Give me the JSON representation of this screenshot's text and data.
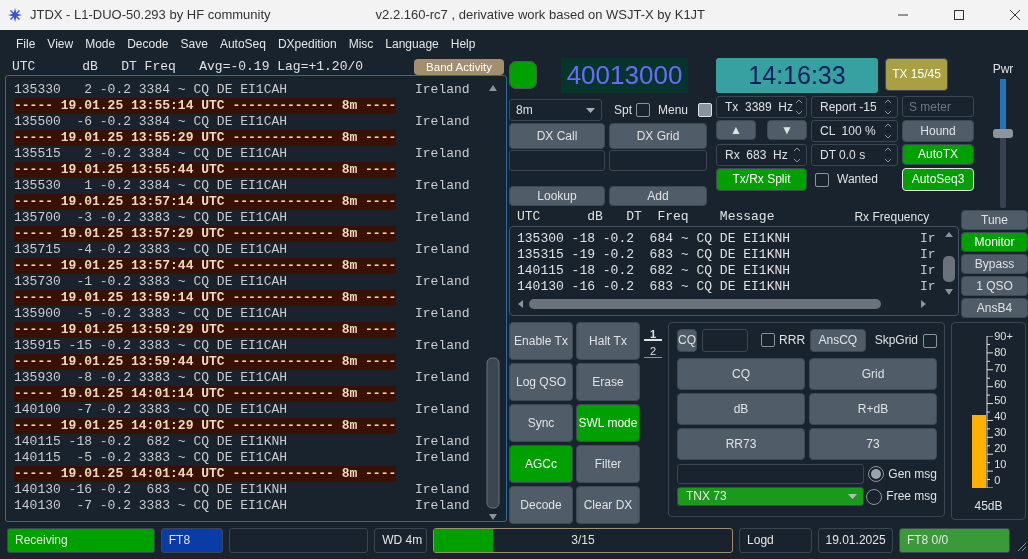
{
  "window": {
    "title": "JTDX - L1-DUO-50.293  by HF community",
    "subtitle": "v2.2.160-rc7 , derivative work based on WSJT-X by K1JT"
  },
  "menu": [
    "File",
    "View",
    "Mode",
    "Decode",
    "Save",
    "AutoSeq",
    "DXpedition",
    "Misc",
    "Language",
    "Help"
  ],
  "band_activity": {
    "header": "UTC      dB   DT Freq   Avg=-0.19 Lag=+1.20/0",
    "title": "Band Activity",
    "rows": [
      {
        "kind": "decode",
        "text": "135330   2 -0.2 3384 ~ CQ DE EI1CAH",
        "country": "Ireland"
      },
      {
        "kind": "separator",
        "text": "----- 19.01.25 13:55:14 UTC ------------- 8m ----"
      },
      {
        "kind": "decode",
        "text": "135500  -6 -0.2 3384 ~ CQ DE EI1CAH",
        "country": "Ireland"
      },
      {
        "kind": "separator",
        "text": "----- 19.01.25 13:55:29 UTC ------------- 8m ----"
      },
      {
        "kind": "decode",
        "text": "135515   2 -0.2 3384 ~ CQ DE EI1CAH",
        "country": "Ireland"
      },
      {
        "kind": "separator",
        "text": "----- 19.01.25 13:55:44 UTC ------------- 8m ----"
      },
      {
        "kind": "decode",
        "text": "135530   1 -0.2 3384 ~ CQ DE EI1CAH",
        "country": "Ireland"
      },
      {
        "kind": "separator",
        "text": "----- 19.01.25 13:57:14 UTC ------------- 8m ----"
      },
      {
        "kind": "decode",
        "text": "135700  -3 -0.2 3383 ~ CQ DE EI1CAH",
        "country": "Ireland"
      },
      {
        "kind": "separator",
        "text": "----- 19.01.25 13:57:29 UTC ------------- 8m ----"
      },
      {
        "kind": "decode",
        "text": "135715  -4 -0.2 3383 ~ CQ DE EI1CAH",
        "country": "Ireland"
      },
      {
        "kind": "separator",
        "text": "----- 19.01.25 13:57:44 UTC ------------- 8m ----"
      },
      {
        "kind": "decode",
        "text": "135730  -1 -0.2 3383 ~ CQ DE EI1CAH",
        "country": "Ireland"
      },
      {
        "kind": "separator",
        "text": "----- 19.01.25 13:59:14 UTC ------------- 8m ----"
      },
      {
        "kind": "decode",
        "text": "135900  -5 -0.2 3383 ~ CQ DE EI1CAH",
        "country": "Ireland"
      },
      {
        "kind": "separator",
        "text": "----- 19.01.25 13:59:29 UTC ------------- 8m ----"
      },
      {
        "kind": "decode",
        "text": "135915 -15 -0.2 3383 ~ CQ DE EI1CAH",
        "country": "Ireland"
      },
      {
        "kind": "separator",
        "text": "----- 19.01.25 13:59:44 UTC ------------- 8m ----"
      },
      {
        "kind": "decode",
        "text": "135930  -8 -0.2 3383 ~ CQ DE EI1CAH",
        "country": "Ireland"
      },
      {
        "kind": "separator",
        "text": "----- 19.01.25 14:01:14 UTC ------------- 8m ----"
      },
      {
        "kind": "decode",
        "text": "140100  -7 -0.2 3383 ~ CQ DE EI1CAH",
        "country": "Ireland"
      },
      {
        "kind": "separator",
        "text": "----- 19.01.25 14:01:29 UTC ------------- 8m ----"
      },
      {
        "kind": "decode",
        "text": "140115 -18 -0.2  682 ~ CQ DE EI1KNH",
        "country": "Ireland"
      },
      {
        "kind": "decode",
        "text": "140115  -5 -0.2 3383 ~ CQ DE EI1CAH",
        "country": "Ireland"
      },
      {
        "kind": "separator",
        "text": "----- 19.01.25 14:01:44 UTC ------------- 8m ----"
      },
      {
        "kind": "decode",
        "text": "140130 -16 -0.2  683 ~ CQ DE EI1KNH",
        "country": "Ireland"
      },
      {
        "kind": "decode",
        "text": "140130  -7 -0.2 3383 ~ CQ DE EI1CAH",
        "country": "Ireland"
      }
    ]
  },
  "controls": {
    "monitor_led": {
      "on": true
    },
    "frequency": "40013000",
    "clock": "14:16:33",
    "tx_period": "TX 15/45",
    "power": {
      "label": "Pwr",
      "level": 0.6
    },
    "band": "8m",
    "spot": {
      "label": "Spt",
      "checked": false
    },
    "menu_toggle": {
      "label": "Menu",
      "checked": true
    },
    "tx_freq": "Tx  3389  Hz",
    "report": "Report -15",
    "s_meter": {
      "placeholder": "S meter"
    },
    "dx_call": "DX Call",
    "dx_grid": "DX Grid",
    "up": "▲",
    "down": "▼",
    "cl": "CL  100 %",
    "hound": {
      "label": "Hound",
      "on": false
    },
    "rx_freq": "Rx  683  Hz",
    "dt": "DT 0.0 s",
    "auto_tx": {
      "label": "AutoTX",
      "on": true
    },
    "split": {
      "label": "Tx/Rx Split",
      "on": true
    },
    "wanted": {
      "label": "Wanted",
      "checked": false
    },
    "auto_seq": {
      "label": "AutoSeq3",
      "on": true
    },
    "lookup": "Lookup",
    "add": "Add"
  },
  "rx_frequency": {
    "header": "UTC      dB   DT  Freq    Message",
    "title": "Rx Frequency",
    "rows": [
      {
        "text": "135300 -18 -0.2  684 ~ CQ DE EI1KNH",
        "country": "Ir"
      },
      {
        "text": "135315 -19 -0.2  683 ~ CQ DE EI1KNH",
        "country": "Ir"
      },
      {
        "text": "140115 -18 -0.2  682 ~ CQ DE EI1KNH",
        "country": "Ir"
      },
      {
        "text": "140130 -16 -0.2  683 ~ CQ DE EI1KNH",
        "country": "Ir"
      }
    ]
  },
  "side_buttons": [
    {
      "label": "Tune",
      "on": false
    },
    {
      "label": "Monitor",
      "on": true
    },
    {
      "label": "Bypass",
      "on": false
    },
    {
      "label": "1 QSO",
      "on": false
    },
    {
      "label": "AnsB4",
      "on": false
    }
  ],
  "action_buttons": [
    {
      "label": "Enable Tx",
      "on": false
    },
    {
      "label": "Halt Tx",
      "on": false
    },
    {
      "label": "Log QSO",
      "on": false
    },
    {
      "label": "Erase",
      "on": false
    },
    {
      "label": "Sync",
      "on": false
    },
    {
      "label": "SWL mode",
      "on": true
    },
    {
      "label": "AGCc",
      "on": true
    },
    {
      "label": "Filter",
      "on": false
    },
    {
      "label": "Decode",
      "on": false
    },
    {
      "label": "Clear DX",
      "on": false
    }
  ],
  "tabs": [
    {
      "label": "1",
      "selected": true
    },
    {
      "label": "2",
      "selected": false
    }
  ],
  "messages": {
    "cq": "CQ",
    "rrr": {
      "label": "RRR",
      "checked": false
    },
    "ans_cq": "AnsCQ",
    "skip_grid": {
      "label": "SkpGrid",
      "checked": false
    },
    "buttons": [
      "CQ",
      "Grid",
      "dB",
      "R+dB",
      "RR73",
      "73"
    ],
    "gen_msg": {
      "label": "Gen msg",
      "selected": true
    },
    "free_msg": {
      "label": "Free msg",
      "selected": false
    },
    "preset": "TNX 73"
  },
  "meter": {
    "scale": [
      "90+",
      "80",
      "70",
      "60",
      "50",
      "40",
      "30",
      "20",
      "10",
      "0"
    ],
    "level": 0.48,
    "reading": "45dB"
  },
  "status_bar": [
    {
      "kind": "text",
      "text": "Receiving",
      "color": "#00a000"
    },
    {
      "kind": "text",
      "text": "FT8",
      "color": "#0a3ca8"
    },
    {
      "kind": "blank"
    },
    {
      "kind": "text",
      "text": "WD 4m"
    },
    {
      "kind": "progress",
      "text": "3/15",
      "level": 0.2
    },
    {
      "kind": "text",
      "text": "Logd"
    },
    {
      "kind": "text",
      "text": "19.01.2025"
    },
    {
      "kind": "text",
      "text": "FT8  0/0",
      "color": "#3a9a3a"
    }
  ]
}
